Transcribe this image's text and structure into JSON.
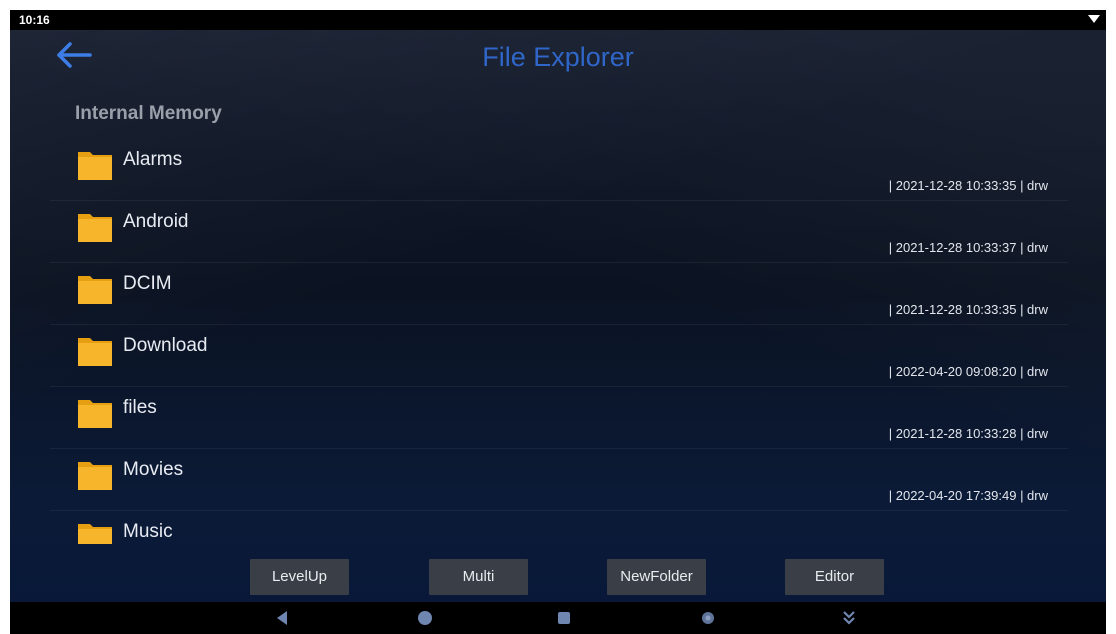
{
  "status_bar": {
    "time": "10:16",
    "wifi_icon": "wifi-signal-icon"
  },
  "header": {
    "back_icon": "back-arrow-icon",
    "title": "File Explorer"
  },
  "location": {
    "label": "Internal Memory"
  },
  "files": [
    {
      "name": "Alarms",
      "meta": "| 2021-12-28 10:33:35 | drw",
      "icon": "folder-icon"
    },
    {
      "name": "Android",
      "meta": "| 2021-12-28 10:33:37 | drw",
      "icon": "folder-icon"
    },
    {
      "name": "DCIM",
      "meta": "| 2021-12-28 10:33:35 | drw",
      "icon": "folder-icon"
    },
    {
      "name": "Download",
      "meta": "| 2022-04-20 09:08:20 | drw",
      "icon": "folder-icon"
    },
    {
      "name": "files",
      "meta": "| 2021-12-28 10:33:28 | drw",
      "icon": "folder-icon"
    },
    {
      "name": "Movies",
      "meta": "| 2022-04-20 17:39:49 | drw",
      "icon": "folder-icon"
    },
    {
      "name": "Music",
      "meta": "",
      "icon": "folder-icon"
    }
  ],
  "toolbar": {
    "levelup_label": "LevelUp",
    "multi_label": "Multi",
    "newfolder_label": "NewFolder",
    "editor_label": "Editor"
  },
  "nav_bar": {
    "back": "nav-back-icon",
    "home": "nav-home-icon",
    "recents": "nav-recents-icon",
    "screenshot": "screenshot-icon",
    "hide": "nav-hide-icon"
  },
  "colors": {
    "title": "#2f66c8",
    "folder": "#f5b01c",
    "background": "#0b1322"
  }
}
